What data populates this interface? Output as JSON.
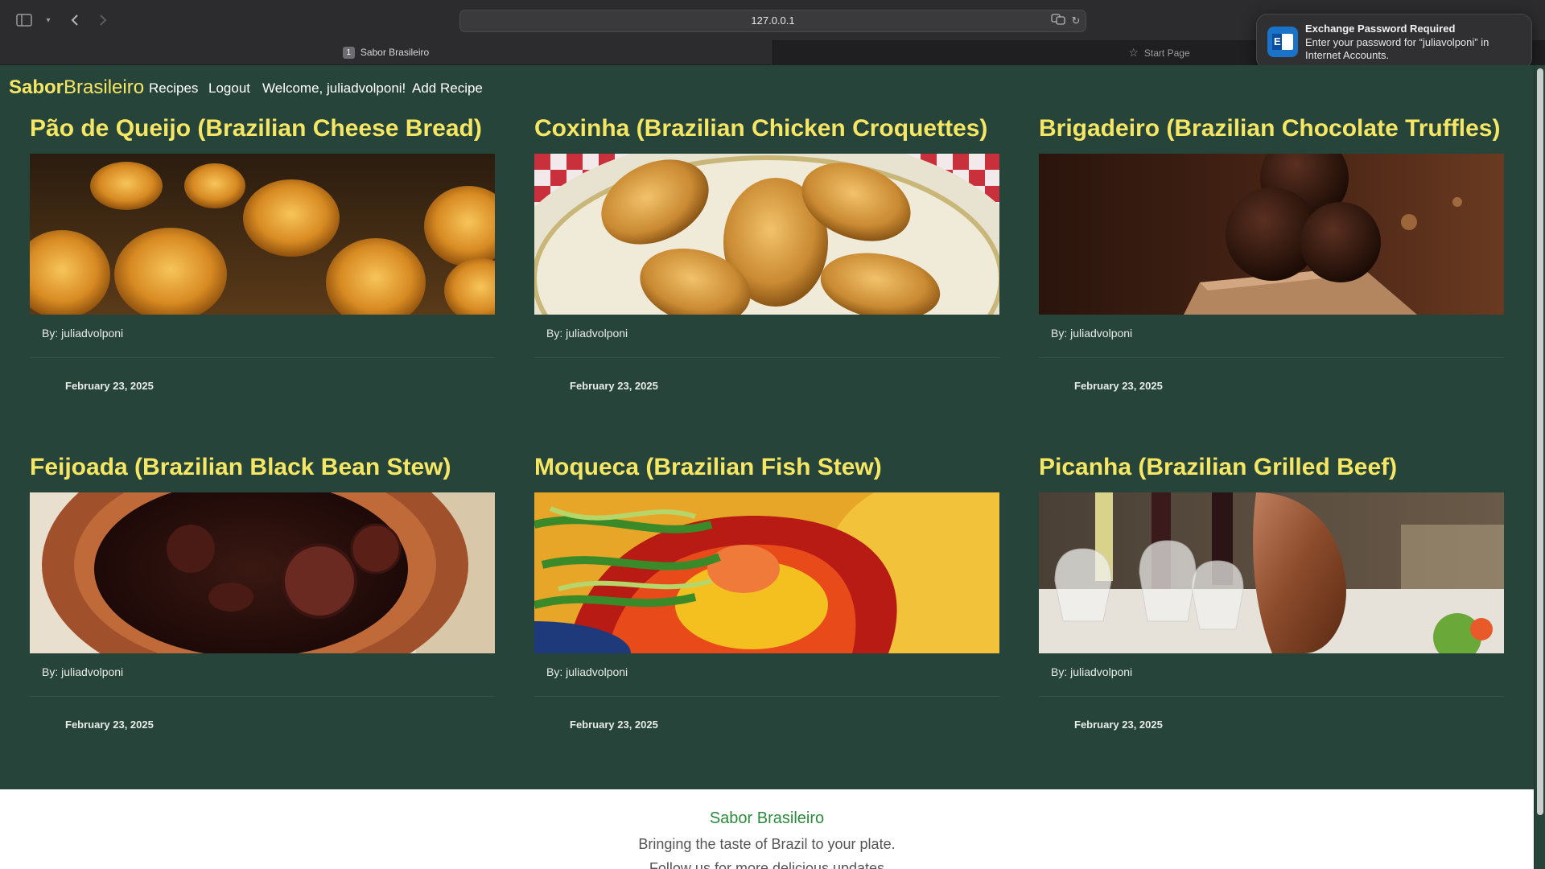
{
  "browser": {
    "url": "127.0.0.1",
    "tabs": [
      {
        "number": "1",
        "label": "Sabor Brasileiro"
      },
      {
        "label": "Start Page"
      }
    ]
  },
  "notification": {
    "title": "Exchange Password Required",
    "body": "Enter your password for “juliavolponi” in Internet Accounts."
  },
  "nav": {
    "brand_bold": "Sabor",
    "brand_regular": "Brasileiro",
    "links": [
      "Recipes",
      "Logout",
      "Welcome, juliadvolponi!",
      "Add Recipe"
    ]
  },
  "recipes": [
    {
      "title": "Pão de Queijo (Brazilian Cheese Bread)",
      "author": "By: juliadvolponi",
      "date": "February 23, 2025"
    },
    {
      "title": "Coxinha (Brazilian Chicken Croquettes)",
      "author": "By: juliadvolponi",
      "date": "February 23, 2025"
    },
    {
      "title": "Brigadeiro (Brazilian Chocolate Truffles)",
      "author": "By: juliadvolponi",
      "date": "February 23, 2025"
    },
    {
      "title": "Feijoada (Brazilian Black Bean Stew)",
      "author": "By: juliadvolponi",
      "date": "February 23, 2025"
    },
    {
      "title": "Moqueca (Brazilian Fish Stew)",
      "author": "By: juliadvolponi",
      "date": "February 23, 2025"
    },
    {
      "title": "Picanha (Brazilian Grilled Beef)",
      "author": "By: juliadvolponi",
      "date": "February 23, 2025"
    }
  ],
  "footer": {
    "title": "Sabor Brasileiro",
    "tagline": "Bringing the taste of Brazil to your plate.",
    "more": "Follow us for more delicious updates"
  },
  "colors": {
    "page_bg": "#27443a",
    "accent_yellow": "#f5e663",
    "footer_green": "#2e8b3d"
  }
}
